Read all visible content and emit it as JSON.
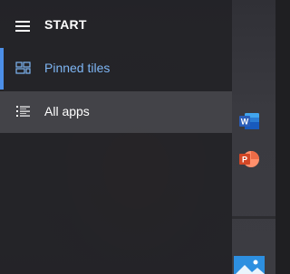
{
  "start_menu": {
    "title": "START",
    "menu_icon": "hamburger-menu-icon",
    "nav_items": [
      {
        "label": "Pinned tiles",
        "icon": "pinned-tiles-icon",
        "selected": true
      },
      {
        "label": "All apps",
        "icon": "all-apps-list-icon",
        "selected": false
      }
    ]
  },
  "background_tiles": [
    {
      "icon": "word-icon",
      "letter": "W"
    },
    {
      "icon": "powerpoint-icon",
      "letter": "P"
    },
    {
      "icon": "photos-icon"
    }
  ],
  "colors": {
    "accent": "#4c8fe8",
    "selected_label": "#7eb6f4",
    "word_blue": "#2b5eb8",
    "powerpoint_orange": "#d24726",
    "photos_blue": "#2d8fe0"
  }
}
